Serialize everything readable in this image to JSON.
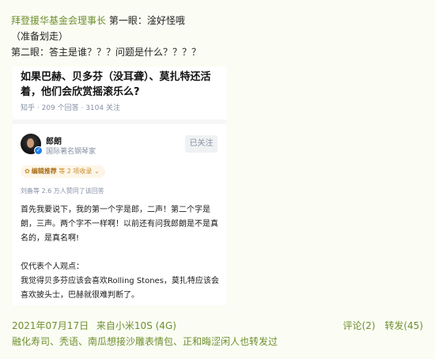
{
  "post": {
    "author": "拜登援华基金会理事长",
    "line1_rest": "第一眼：淦好怪哦",
    "line2": "（准备划走）",
    "line3": "第二眼：答主是谁？？？问题是什么？？？？"
  },
  "card": {
    "question_title": "如果巴赫、贝多芬（没耳聋）、莫扎特还活着，他们会欣赏摇滚乐么?",
    "question_meta": "知乎 · 209 个回答 · 3104 关注",
    "answerer": {
      "name": "郎朗",
      "subtitle": "国际著名钢琴家",
      "badge_icon": "verified-icon"
    },
    "follow_label": "已关注",
    "recommend": {
      "label": "编辑推荐",
      "count": "等 2 项收录",
      "icon": "award-icon",
      "chevron": "chevron-down-icon"
    },
    "agree_text": "刘备等 2.6 万人赞同了该回答",
    "body": [
      "首先我要说下，我的第一个字是郎，二声！第二个字是朗，三声。两个字不一样啊！以前还有问我郎朗是不是真名的，是真名啊!",
      "",
      "仅代表个人观点：",
      "我觉得贝多芬应该会喜欢Rolling Stones，莫扎特应该会喜欢披头士，巴赫就很难判断了。"
    ]
  },
  "footer": {
    "date": "2021年07月17日",
    "source": "来自小米10S (4G)",
    "comments": "评论(2)",
    "reposts": "转发(45)",
    "repost_line": "融化寿司、秃语、南瓜想接沙雕表情包、正和晦涩闲人也转发过"
  },
  "colors": {
    "link_green": "#6f8f2f",
    "page_bg": "#fbfdf4",
    "verified_blue": "#1e7ee8",
    "recommend_orange": "#c98a2b"
  }
}
